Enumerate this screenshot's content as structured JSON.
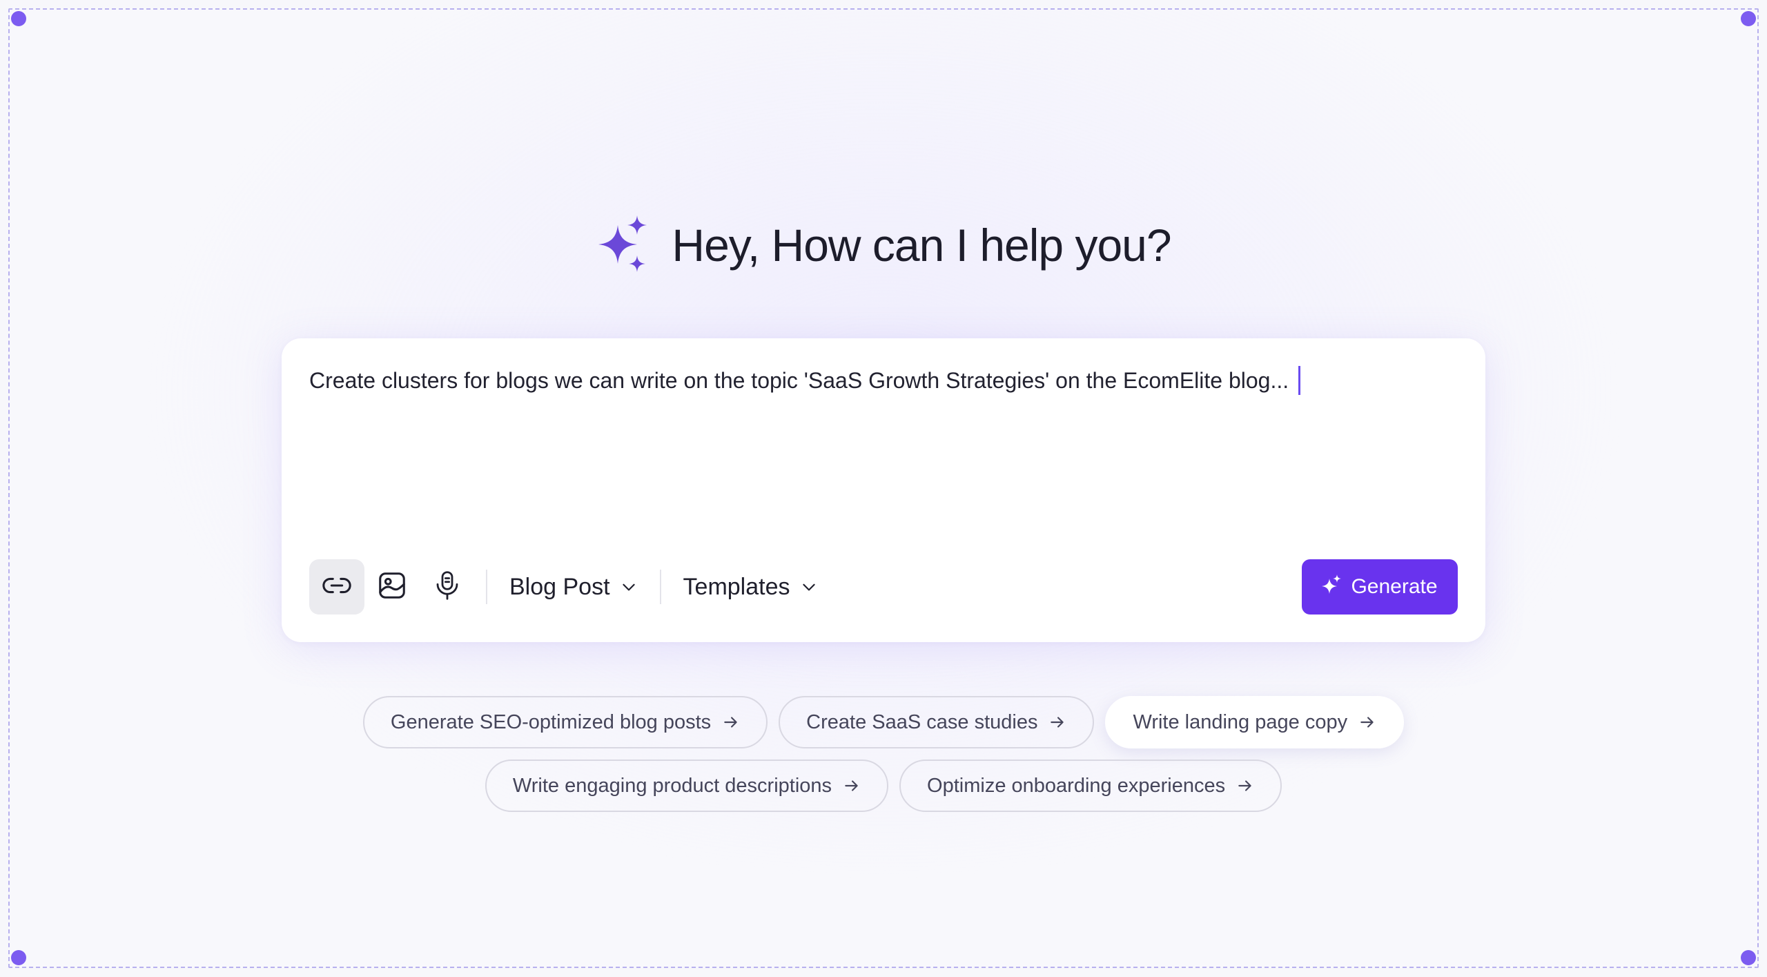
{
  "header": {
    "title": "Hey, How can I help you?",
    "icon": "sparkles-icon"
  },
  "composer": {
    "prompt_text": "Create clusters for blogs we can write on the topic 'SaaS Growth Strategies' on the EcomElite blog...",
    "toolbar": {
      "link_icon": "link-icon",
      "image_icon": "image-icon",
      "mic_icon": "microphone-icon",
      "content_type": "Blog Post",
      "templates": "Templates",
      "generate_label": "Generate"
    }
  },
  "suggestions": [
    "Generate SEO-optimized blog posts",
    "Create SaaS case studies",
    "Write landing page copy",
    "Write engaging product descriptions",
    "Optimize onboarding experiences"
  ],
  "colors": {
    "accent": "#6933ee",
    "caret": "#6a4bf0",
    "sparkle": "#6b48d8",
    "frame_dash": "#b7b0ee"
  }
}
